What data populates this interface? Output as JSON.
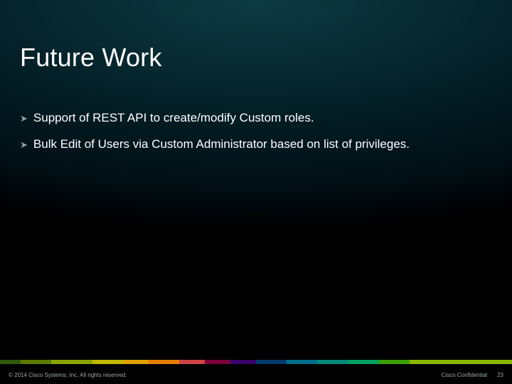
{
  "title": "Future Work",
  "bullets": [
    "Support of REST API to create/modify Custom roles.",
    "Bulk Edit of Users via Custom Administrator based on list of privileges."
  ],
  "footer": {
    "copyright": "© 2014 Cisco Systems, Inc. All rights reserved.",
    "confidential": "Cisco Confidential",
    "page": "23"
  }
}
